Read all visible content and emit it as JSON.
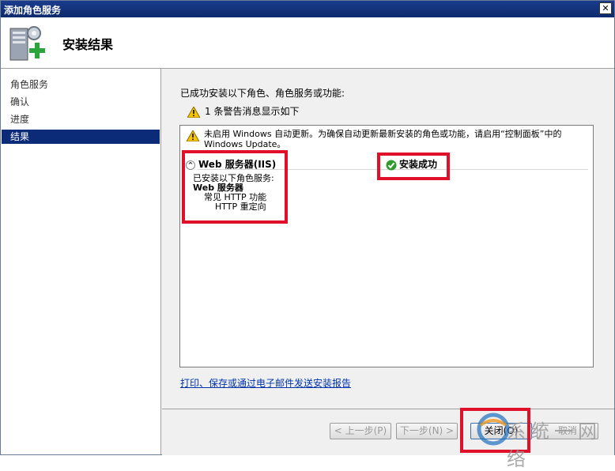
{
  "window": {
    "title": "添加角色服务",
    "close_symbol": "✕"
  },
  "header": {
    "title": "安装结果",
    "icon": "server-add-icon"
  },
  "sidebar": {
    "items": [
      {
        "label": "角色服务",
        "active": false
      },
      {
        "label": "确认",
        "active": false
      },
      {
        "label": "进度",
        "active": false
      },
      {
        "label": "结果",
        "active": true
      }
    ]
  },
  "main": {
    "success_message": "已成功安装以下角色、角色服务或功能:",
    "warning_summary": "1 条警告消息显示如下",
    "note_text": "未启用 Windows 自动更新。为确保自动更新最新安装的角色或功能，请启用“控制面板”中的 Windows Update。",
    "role_title": "Web 服务器(IIS)",
    "role_status": "安装成功",
    "details": {
      "line1": "已安装以下角色服务:",
      "line2": "Web 服务器",
      "line3": "常见 HTTP 功能",
      "line4": "HTTP 重定向"
    },
    "report_link": "打印、保存或通过电子邮件发送安装报告"
  },
  "footer": {
    "prev_label": "< 上一步(P)",
    "next_label": "下一步(N) >",
    "close_label": "关闭(O)",
    "cancel_label": "取消"
  },
  "watermark": {
    "text": "系统一网络"
  },
  "colors": {
    "title_bar": "#0d2a6e",
    "sidebar_active": "#0b2a78",
    "highlight_box": "#e0102a",
    "link": "#0033aa"
  }
}
